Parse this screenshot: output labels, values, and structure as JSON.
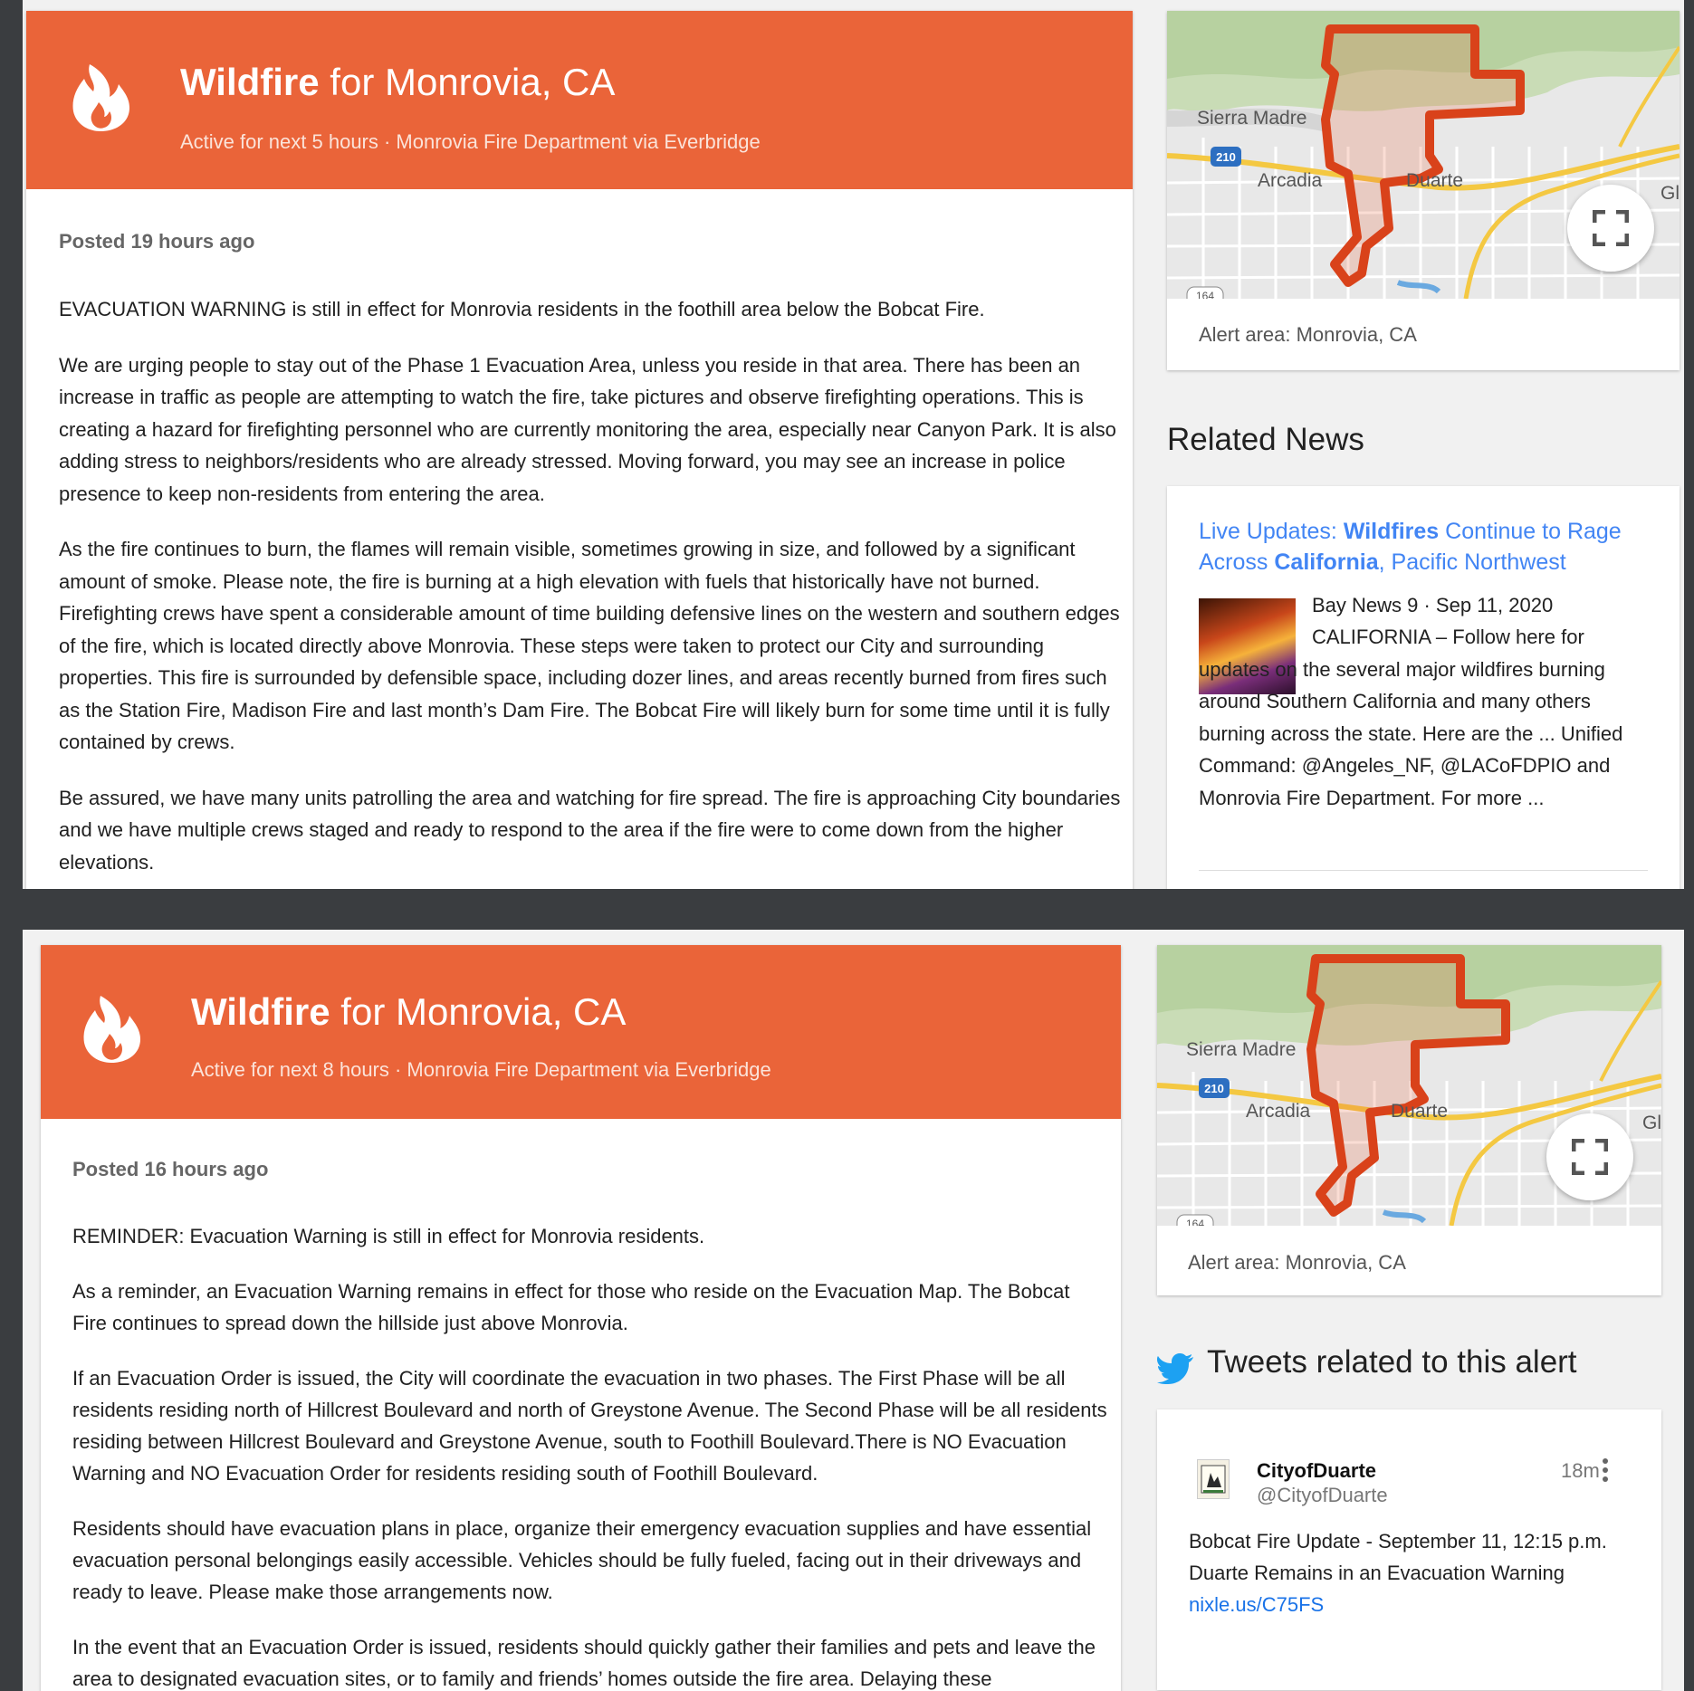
{
  "screens": [
    {
      "header": {
        "title_bold": "Wildfire",
        "title_rest": " for Monrovia, CA",
        "subtitle": "Active for next 5 hours · Monrovia Fire Department via Everbridge"
      },
      "posted": "Posted 19 hours ago",
      "paragraphs": [
        "EVACUATION WARNING is still in effect for Monrovia residents in the foothill area below the Bobcat Fire.",
        "We are urging people to stay out of the Phase 1 Evacuation Area, unless you reside in that area. There has been an increase in traffic as people are attempting to watch the fire, take pictures and observe firefighting operations. This is creating a hazard for firefighting personnel who are currently monitoring the area, especially near Canyon Park. It is also adding stress to neighbors/residents who are already stressed. Moving forward, you may see an increase in police presence to keep non-residents from entering the area.",
        "As the fire continues to burn, the flames will remain visible, sometimes growing in size, and followed by a significant amount of smoke. Please note, the fire is burning at a high elevation with fuels that historically have not burned. Firefighting crews have spent a considerable amount of time building defensive lines on the western and southern edges of the fire, which is located directly above Monrovia. These steps were taken to protect our City and surrounding properties. This fire is surrounded by defensible space, including dozer lines, and areas recently burned from fires such as the Station Fire, Madison Fire and last month’s Dam Fire. The Bobcat Fire will likely burn for some time until it is fully contained by crews.",
        "Be assured, we have many units patrolling the area and watching for fire spread. The fire is approaching City boundaries and we have multiple crews staged and ready to respond to the area if the fire were to come down from the higher elevations."
      ],
      "map": {
        "labels": {
          "sierra_madre": "Sierra Madre",
          "arcadia": "Arcadia",
          "duarte": "Duarte",
          "gl": "Gl",
          "hwy210": "210",
          "hwy164": "164"
        },
        "alert_area": "Alert area: Monrovia, CA"
      },
      "related": {
        "heading": "Related News",
        "news_title_parts": [
          "Live Updates: ",
          "Wildfires",
          " Continue to Rage Across ",
          "California",
          ", Pacific Northwest"
        ],
        "source": "Bay News 9 · Sep 11, 2020",
        "snippet": "CALIFORNIA – Follow here for updates on the several major wildfires burning around Southern California and many others burning across the state. Here are the ... Unified Command: @Angeles_NF, @LACoFDPIO and Monrovia Fire Department. For more ..."
      }
    },
    {
      "header": {
        "title_bold": "Wildfire",
        "title_rest": " for Monrovia, CA",
        "subtitle": "Active for next 8 hours · Monrovia Fire Department via Everbridge"
      },
      "posted": "Posted 16 hours ago",
      "paragraphs": [
        "REMINDER: Evacuation Warning is still in effect for Monrovia residents.",
        "As a reminder, an Evacuation Warning remains in effect for those who reside on the Evacuation Map. The Bobcat Fire continues to spread down the hillside just above Monrovia.",
        "If an Evacuation Order is issued, the City will coordinate the evacuation in two phases. The First Phase will be all residents residing north of Hillcrest Boulevard and north of Greystone Avenue. The Second Phase will be all residents residing between Hillcrest Boulevard and Greystone Avenue, south to Foothill Boulevard.There is NO Evacuation Warning and NO Evacuation Order for residents residing south of Foothill Boulevard.",
        "Residents should have evacuation plans in place, organize their emergency evacuation supplies and have essential evacuation personal belongings easily accessible. Vehicles should be fully fueled, facing out in their driveways and ready to leave. Please make those arrangements now.",
        "In the event that an Evacuation Order is issued, residents should quickly gather their families and pets and leave the area to designated evacuation sites, or to family and friends’ homes outside the fire area. Delaying these"
      ],
      "map": {
        "labels": {
          "sierra_madre": "Sierra Madre",
          "arcadia": "Arcadia",
          "duarte": "Duarte",
          "gl": "Gl",
          "hwy210": "210",
          "hwy164": "164"
        },
        "alert_area": "Alert area: Monrovia, CA"
      },
      "tweets": {
        "heading": "Tweets related to this alert",
        "name": "CityofDuarte",
        "handle": "@CityofDuarte",
        "time": "18m",
        "line1": "Bobcat Fire Update - September 11, 12:15 p.m.",
        "line2": "Duarte Remains in an Evacuation Warning",
        "link": "nixle.us/C75FS"
      }
    }
  ]
}
